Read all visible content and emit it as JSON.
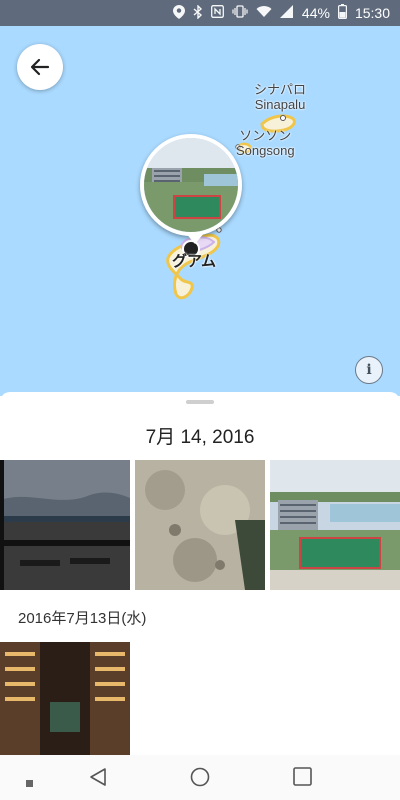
{
  "status_bar": {
    "battery": "44%",
    "time": "15:30",
    "icons": [
      "location-icon",
      "bluetooth-icon",
      "nfc-icon",
      "vibrate-icon",
      "wifi-icon",
      "signal-icon",
      "battery-icon"
    ]
  },
  "map": {
    "places": [
      {
        "name_ja": "シナパロ",
        "name_en": "Sinapalu"
      },
      {
        "name_ja": "ソンソン",
        "name_en": "Songsong"
      },
      {
        "name_ja": "グアム",
        "name_en": ""
      }
    ],
    "back_icon": "arrow-back-icon",
    "info_icon": "info-icon"
  },
  "sheet": {
    "date_title": "7月 14, 2016",
    "section_label": "2016年7月13日(水)"
  },
  "nav": {
    "icons": [
      "menu-dot-icon",
      "back-triangle-icon",
      "home-circle-icon",
      "recents-square-icon"
    ]
  },
  "colors": {
    "map_water": "#aadaff",
    "status_bar": "#5f6b7c",
    "island": "#f7f1d9",
    "island_outline": "#f0c64a"
  }
}
